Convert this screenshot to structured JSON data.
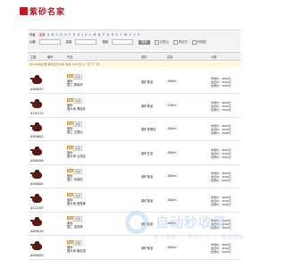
{
  "logo": {
    "text": "紫砂名家"
  },
  "filter": {
    "letters_label": "作者",
    "letters": [
      "全部",
      "A",
      "B",
      "C",
      "D",
      "E",
      "F",
      "G",
      "H",
      "J",
      "K",
      "L",
      "M",
      "N",
      "P",
      "Q",
      "R",
      "S",
      "T",
      "W",
      "X",
      "Y",
      "Z"
    ],
    "price_label": "价格",
    "volume_label": "容量",
    "search_label": "搜索",
    "search_button": "搜索",
    "opt1": "已售出",
    "opt2": "附证书",
    "opt3": "有视频"
  },
  "table": {
    "headers": [
      "主图",
      "编号",
      "作品",
      "泥料",
      "容量",
      "价格"
    ]
  },
  "status": {
    "text": "共1289条记录 每页显示15条 当前 1/86 页 上一页 下一页"
  },
  "rows": [
    {
      "code": "#808557",
      "tag": "精品",
      "tag2": "收藏",
      "cat": "紫砂",
      "author": "国工 顾景舟",
      "material": "原矿紫泥",
      "volume": "180ml",
      "p1": "市场价：4800元",
      "p2": "会员价：4200元",
      "p3": "优惠价：3900元"
    },
    {
      "code": "#201122",
      "tag": "精品",
      "tag2": "收藏",
      "cat": "紫砂",
      "author": "国大师 周桂珍",
      "material": "原矿紫泥",
      "volume": "170ml",
      "p1": "市场价：4800元",
      "p2": "会员价：4200元",
      "p3": "优惠价：3900元"
    },
    {
      "code": "#806622",
      "tag": "精品",
      "tag2": "收藏",
      "cat": "紫砂",
      "author": "国工 汪寅仙",
      "material": "原矿底槽清",
      "volume": "180ml",
      "p1": "市场价：4800元",
      "p2": "会员价：4200元",
      "p3": "优惠价：3900元"
    },
    {
      "code": "#806490",
      "tag": "精品",
      "tag2": "收藏",
      "cat": "紫砂",
      "author": "国大师 吕尧臣",
      "material": "原矿红泥",
      "volume": "180ml",
      "p1": "市场价：4800元",
      "p2": "会员价：4200元",
      "p3": "优惠价：3900元"
    },
    {
      "code": "#806601",
      "tag": "精品",
      "tag2": "收藏",
      "cat": "紫砂",
      "author": "国工 何道洪",
      "material": "原矿紫泥",
      "volume": "180ml",
      "p1": "市场价：4800元",
      "p2": "会员价：4200元",
      "p3": "优惠价：3900元"
    },
    {
      "code": "#122497",
      "tag": "精品",
      "tag2": "收藏",
      "cat": "紫砂",
      "author": "国大师 徐秀棠",
      "material": "原矿紫泥",
      "volume": "180ml",
      "p1": "市场价：4800元",
      "p2": "会员价：4200元",
      "p3": "优惠价：3900元"
    },
    {
      "code": "#806250",
      "tag": "精品",
      "tag2": "收藏",
      "cat": "紫砂",
      "author": "国工 谭泉海",
      "material": "原矿紫泥",
      "volume": "180ml",
      "p1": "市场价：4800元",
      "p2": "会员价：4200元",
      "p3": "优惠价：3900元"
    },
    {
      "code": "#806005",
      "tag": "精品",
      "tag2": "收藏",
      "cat": "紫砂",
      "author": "国大师 鲍志强",
      "material": "原矿紫泥",
      "volume": "180ml",
      "p1": "市场价：4800元",
      "p2": "会员价：4200元",
      "p3": "优惠价：3900元"
    }
  ],
  "watermark": {
    "title": "自动秒收录",
    "sub": "做上链接 — 来访一次 — 自动收录"
  },
  "colors": {
    "brand": "#b5121b",
    "tag": "#e08a1e",
    "status_bg": "#fff8dc"
  }
}
